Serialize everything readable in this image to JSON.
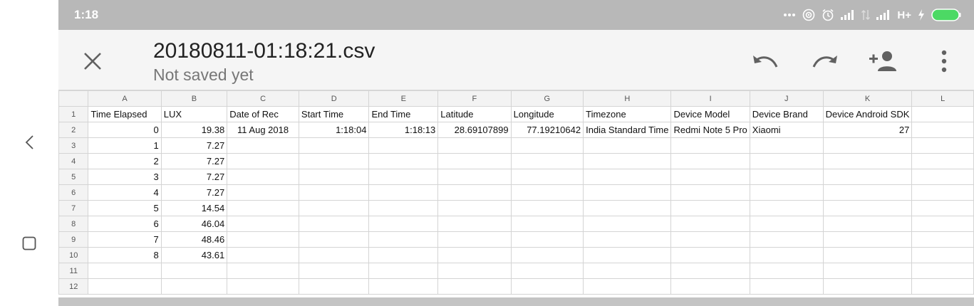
{
  "status": {
    "time": "1:18",
    "network": "H+"
  },
  "file": {
    "name": "20180811-01:18:21.csv",
    "status": "Not saved yet"
  },
  "icons": {
    "close": "close-icon",
    "undo": "undo-icon",
    "redo": "redo-icon",
    "share": "add-person-icon",
    "more": "more-vert-icon",
    "back": "back-chevron-icon",
    "recents": "recents-square-icon"
  },
  "sheet": {
    "columns": [
      "A",
      "B",
      "C",
      "D",
      "E",
      "F",
      "G",
      "H",
      "I",
      "J",
      "K",
      "L"
    ],
    "rows": [
      [
        "Time Elapsed",
        "LUX",
        "Date of Rec",
        "Start Time",
        "End Time",
        "Latitude",
        "Longitude",
        "Timezone",
        "Device Model",
        "Device Brand",
        "Device Android SDK",
        ""
      ],
      [
        "0",
        "19.38",
        "11 Aug 2018",
        "1:18:04",
        "1:18:13",
        "28.69107899",
        "77.19210642",
        "India Standard Time",
        "Redmi Note 5 Pro",
        "Xiaomi",
        "27",
        ""
      ],
      [
        "1",
        "7.27",
        "",
        "",
        "",
        "",
        "",
        "",
        "",
        "",
        "",
        ""
      ],
      [
        "2",
        "7.27",
        "",
        "",
        "",
        "",
        "",
        "",
        "",
        "",
        "",
        ""
      ],
      [
        "3",
        "7.27",
        "",
        "",
        "",
        "",
        "",
        "",
        "",
        "",
        "",
        ""
      ],
      [
        "4",
        "7.27",
        "",
        "",
        "",
        "",
        "",
        "",
        "",
        "",
        "",
        ""
      ],
      [
        "5",
        "14.54",
        "",
        "",
        "",
        "",
        "",
        "",
        "",
        "",
        "",
        ""
      ],
      [
        "6",
        "46.04",
        "",
        "",
        "",
        "",
        "",
        "",
        "",
        "",
        "",
        ""
      ],
      [
        "7",
        "48.46",
        "",
        "",
        "",
        "",
        "",
        "",
        "",
        "",
        "",
        ""
      ],
      [
        "8",
        "43.61",
        "",
        "",
        "",
        "",
        "",
        "",
        "",
        "",
        "",
        ""
      ],
      [
        "",
        "",
        "",
        "",
        "",
        "",
        "",
        "",
        "",
        "",
        "",
        ""
      ],
      [
        "",
        "",
        "",
        "",
        "",
        "",
        "",
        "",
        "",
        "",
        "",
        ""
      ]
    ],
    "row_numbers": [
      "1",
      "2",
      "3",
      "4",
      "5",
      "6",
      "7",
      "8",
      "9",
      "10",
      "11",
      "12"
    ]
  }
}
